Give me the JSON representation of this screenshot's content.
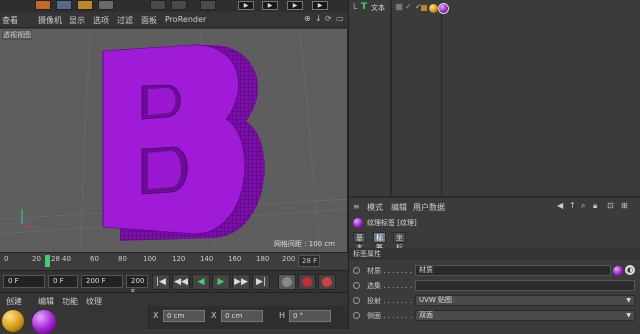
{
  "topbar": {
    "film_labels": [
      "▶",
      "▶",
      "▶",
      "▶"
    ]
  },
  "viewport_menu": {
    "items": [
      "查看",
      "摄像机",
      "显示",
      "选项",
      "过滤",
      "面板",
      "ProRender"
    ],
    "nav_icons": [
      "⊕",
      "↓",
      "⟳",
      "▭"
    ]
  },
  "viewport": {
    "label": "透视视图",
    "grid_distance": "网格间距 : 100 cm",
    "letter": "B"
  },
  "timeline": {
    "ticks": [
      "0",
      "20",
      "28",
      "40",
      "60",
      "80",
      "100",
      "120",
      "140",
      "160",
      "180",
      "200"
    ],
    "current_frame_marker": 28,
    "frame_field": "28 F"
  },
  "transport": {
    "start_field": "0 F",
    "preview_start": "0 F",
    "end_field": "200 F",
    "preview_end": "200 F",
    "buttons": [
      "|◀",
      "◀◀",
      "◀",
      "▶",
      "▶▶",
      "▶|"
    ]
  },
  "material_panel": {
    "tabs": [
      "创建",
      "编辑",
      "功能",
      "纹理"
    ]
  },
  "coords": {
    "x_label": "X",
    "x_value": "0 cm",
    "x2_label": "X",
    "x2_value": "0 cm",
    "h_label": "H",
    "h_value": "0 °"
  },
  "object_manager": {
    "object_name": "文本"
  },
  "attributes": {
    "menu": [
      "模式",
      "编辑",
      "用户数据"
    ],
    "title": "纹理标签 [纹理]",
    "tabs": [
      "基本",
      "标签",
      "坐标"
    ],
    "active_tab": "标签",
    "section": "标签属性",
    "rows": [
      {
        "label": "材质 . . . . . . .",
        "value": "材质",
        "type": "field"
      },
      {
        "label": "选集 . . . . . . .",
        "value": "",
        "type": "field"
      },
      {
        "label": "投射 . . . . . . .",
        "value": "UVW 贴图",
        "type": "drop"
      },
      {
        "label": "侧面 . . . . . . .",
        "value": "双面",
        "type": "drop"
      }
    ]
  },
  "colors": {
    "letter_face": "#a01bd8",
    "letter_side": "#7a0fa8",
    "viewport_bg": "#5e5e5e",
    "timeline_marker": "#3fd06b",
    "active_tab": "#6c7c90"
  }
}
